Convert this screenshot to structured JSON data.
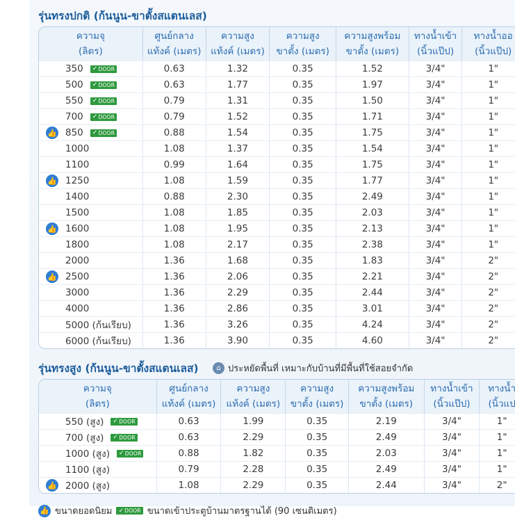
{
  "standard": {
    "title": "รุ่นทรงปกติ (ก้นนูน-ขาตั้งสแตนเลส)",
    "headers": [
      [
        "ความจุ",
        "(ลิตร)"
      ],
      [
        "ศูนย์กลาง",
        "แท้งค์ (เมตร)"
      ],
      [
        "ความสูง",
        "แท้งค์ (เมตร)"
      ],
      [
        "ความสูง",
        "ขาตั้ง (เมตร)"
      ],
      [
        "ความสูงพร้อม",
        "ขาตั้ง (เมตร)"
      ],
      [
        "ทางน้ำเข้า",
        "(นิ้วแป๊ป)"
      ],
      [
        "ทางน้ำออ",
        "(นิ้วแป๊ป)"
      ]
    ],
    "rows": [
      {
        "cap": "350",
        "popular": false,
        "door": true,
        "vals": [
          "0.63",
          "1.32",
          "0.35",
          "1.52",
          "3/4\"",
          "1\""
        ]
      },
      {
        "cap": "500",
        "popular": false,
        "door": true,
        "vals": [
          "0.63",
          "1.77",
          "0.35",
          "1.97",
          "3/4\"",
          "1\""
        ]
      },
      {
        "cap": "550",
        "popular": false,
        "door": true,
        "vals": [
          "0.79",
          "1.31",
          "0.35",
          "1.50",
          "3/4\"",
          "1\""
        ]
      },
      {
        "cap": "700",
        "popular": false,
        "door": true,
        "vals": [
          "0.79",
          "1.52",
          "0.35",
          "1.71",
          "3/4\"",
          "1\""
        ]
      },
      {
        "cap": "850",
        "popular": true,
        "door": true,
        "vals": [
          "0.88",
          "1.54",
          "0.35",
          "1.75",
          "3/4\"",
          "1\""
        ]
      },
      {
        "cap": "1000",
        "popular": false,
        "door": false,
        "vals": [
          "1.08",
          "1.37",
          "0.35",
          "1.54",
          "3/4\"",
          "1\""
        ]
      },
      {
        "cap": "1100",
        "popular": false,
        "door": false,
        "vals": [
          "0.99",
          "1.64",
          "0.35",
          "1.75",
          "3/4\"",
          "1\""
        ]
      },
      {
        "cap": "1250",
        "popular": true,
        "door": false,
        "vals": [
          "1.08",
          "1.59",
          "0.35",
          "1.77",
          "3/4\"",
          "1\""
        ]
      },
      {
        "cap": "1400",
        "popular": false,
        "door": false,
        "vals": [
          "0.88",
          "2.30",
          "0.35",
          "2.49",
          "3/4\"",
          "1\""
        ]
      },
      {
        "cap": "1500",
        "popular": false,
        "door": false,
        "vals": [
          "1.08",
          "1.85",
          "0.35",
          "2.03",
          "3/4\"",
          "1\""
        ]
      },
      {
        "cap": "1600",
        "popular": true,
        "door": false,
        "vals": [
          "1.08",
          "1.95",
          "0.35",
          "2.13",
          "3/4\"",
          "1\""
        ]
      },
      {
        "cap": "1800",
        "popular": false,
        "door": false,
        "vals": [
          "1.08",
          "2.17",
          "0.35",
          "2.38",
          "3/4\"",
          "1\""
        ]
      },
      {
        "cap": "2000",
        "popular": false,
        "door": false,
        "vals": [
          "1.36",
          "1.68",
          "0.35",
          "1.83",
          "3/4\"",
          "2\""
        ]
      },
      {
        "cap": "2500",
        "popular": true,
        "door": false,
        "vals": [
          "1.36",
          "2.06",
          "0.35",
          "2.21",
          "3/4\"",
          "2\""
        ]
      },
      {
        "cap": "3000",
        "popular": false,
        "door": false,
        "vals": [
          "1.36",
          "2.29",
          "0.35",
          "2.44",
          "3/4\"",
          "2\""
        ]
      },
      {
        "cap": "4000",
        "popular": false,
        "door": false,
        "vals": [
          "1.36",
          "2.86",
          "0.35",
          "3.01",
          "3/4\"",
          "2\""
        ]
      },
      {
        "cap": "5000 (ก้นเรียบ)",
        "popular": false,
        "door": false,
        "vals": [
          "1.36",
          "3.26",
          "0.35",
          "4.24",
          "3/4\"",
          "2\""
        ]
      },
      {
        "cap": "6000 (ก้นเรียบ)",
        "popular": false,
        "door": false,
        "vals": [
          "1.36",
          "3.90",
          "0.35",
          "4.60",
          "3/4\"",
          "2\""
        ]
      }
    ]
  },
  "tall": {
    "title": "รุ่นทรงสูง (ก้นนูน-ขาตั้งสแตนเลส)",
    "note": "ประหยัดพื้นที่ เหมาะกับบ้านที่มีพื้นที่ใช้สอยจำกัด",
    "headers": [
      [
        "ความจุ",
        "(ลิตร)"
      ],
      [
        "ศูนย์กลาง",
        "แท้งค์ (เมตร)"
      ],
      [
        "ความสูง",
        "แท้งค์ (เมตร)"
      ],
      [
        "ความสูง",
        "ขาตั้ง (เมตร)"
      ],
      [
        "ความสูงพร้อม",
        "ขาตั้ง (เมตร)"
      ],
      [
        "ทางน้ำเข้า",
        "(นิ้วแป๊ป)"
      ],
      [
        "ทางน้ำ",
        "(นิ้วแป"
      ]
    ],
    "rows": [
      {
        "cap": "550 (สูง)",
        "popular": false,
        "door": true,
        "vals": [
          "0.63",
          "1.99",
          "0.35",
          "2.19",
          "3/4\"",
          "1\""
        ]
      },
      {
        "cap": "700 (สูง)",
        "popular": false,
        "door": true,
        "vals": [
          "0.63",
          "2.29",
          "0.35",
          "2.49",
          "3/4\"",
          "1\""
        ]
      },
      {
        "cap": "1000 (สูง)",
        "popular": false,
        "door": true,
        "vals": [
          "0.88",
          "1.82",
          "0.35",
          "2.03",
          "3/4\"",
          "1\""
        ]
      },
      {
        "cap": "1100 (สูง)",
        "popular": false,
        "door": false,
        "vals": [
          "0.79",
          "2.28",
          "0.35",
          "2.49",
          "3/4\"",
          "1\""
        ]
      },
      {
        "cap": "2000 (สูง)",
        "popular": true,
        "door": false,
        "vals": [
          "1.08",
          "2.29",
          "0.35",
          "2.44",
          "3/4\"",
          "2\""
        ]
      }
    ]
  },
  "badge": {
    "label": "DOOR",
    "check": "✓"
  },
  "icons": {
    "popular": "thumbs-up-icon",
    "saving": "saving-icon"
  },
  "legend": {
    "popular_text": "ขนาดยอดนิยม",
    "door_text": "ขนาดเข้าประตูบ้านมาตรฐานได้ (90 เซนติเมตร)"
  },
  "colors": {
    "title": "#1d5c9b",
    "header_text": "#2b6cb0",
    "popular_icon": "#2f7dd6",
    "door_badge": "#2e9a3e"
  }
}
